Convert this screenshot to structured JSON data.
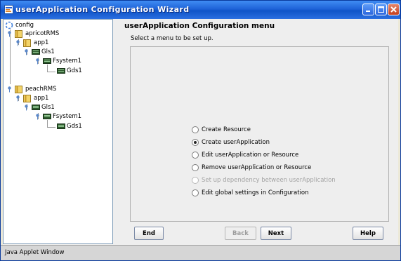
{
  "window": {
    "title": "userApplication Configuration Wizard"
  },
  "tree": {
    "root": "config",
    "nodes": [
      {
        "label": "apricotRMS",
        "icon": "folder-icon"
      },
      {
        "label": "app1",
        "icon": "folder-icon"
      },
      {
        "label": "Gls1",
        "icon": "resource-icon"
      },
      {
        "label": "Fsystem1",
        "icon": "resource-icon"
      },
      {
        "label": "Gds1",
        "icon": "resource-icon"
      },
      {
        "label": "peachRMS",
        "icon": "folder-icon"
      },
      {
        "label": "app1",
        "icon": "folder-icon"
      },
      {
        "label": "Gls1",
        "icon": "resource-icon"
      },
      {
        "label": "Fsystem1",
        "icon": "resource-icon"
      },
      {
        "label": "Gds1",
        "icon": "resource-icon"
      }
    ]
  },
  "main": {
    "title": "userApplication Configuration menu",
    "subtitle": "Select a menu to be set up.",
    "options": [
      {
        "label": "Create Resource",
        "selected": false,
        "enabled": true
      },
      {
        "label": "Create userApplication",
        "selected": true,
        "enabled": true
      },
      {
        "label": "Edit userApplication or Resource",
        "selected": false,
        "enabled": true
      },
      {
        "label": "Remove userApplication or Resource",
        "selected": false,
        "enabled": true
      },
      {
        "label": "Set up dependency between userApplication",
        "selected": false,
        "enabled": false
      },
      {
        "label": "Edit global settings in Configuration",
        "selected": false,
        "enabled": true
      }
    ]
  },
  "buttons": {
    "end": "End",
    "back": "Back",
    "next": "Next",
    "help": "Help"
  },
  "status": {
    "text": "Java Applet Window"
  },
  "colors": {
    "title_bar": "#1f63d8",
    "close_button": "#c4401f",
    "panel_bg": "#eeeeee",
    "disabled_text": "#a3a3a3"
  }
}
